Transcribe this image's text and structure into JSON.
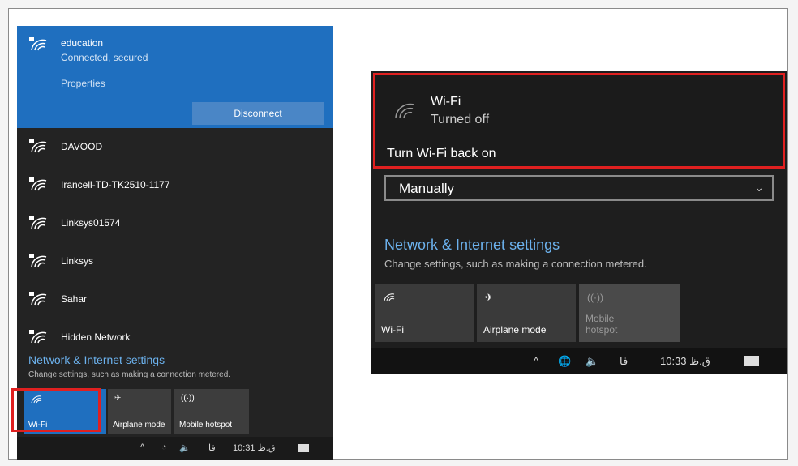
{
  "left": {
    "connected": {
      "name": "education",
      "status": "Connected, secured",
      "properties": "Properties",
      "disconnect": "Disconnect"
    },
    "networks": [
      "DAVOOD",
      "Irancell-TD-TK2510-1177",
      "Linksys01574",
      "Linksys",
      "Sahar",
      "Hidden Network"
    ],
    "settings_title": "Network & Internet settings",
    "settings_sub": "Change settings, such as making a connection metered.",
    "tiles": [
      {
        "label": "Wi-Fi"
      },
      {
        "label": "Airplane mode"
      },
      {
        "label": "Mobile hotspot"
      }
    ],
    "taskbar": {
      "lang": "فا",
      "time": "10:31 ق.ظ"
    }
  },
  "right": {
    "wifi_title": "Wi-Fi",
    "wifi_status": "Turned off",
    "turn_back": "Turn Wi-Fi back on",
    "select_value": "Manually",
    "settings_title": "Network & Internet settings",
    "settings_sub": "Change settings, such as making a connection metered.",
    "tiles": [
      {
        "label": "Wi-Fi"
      },
      {
        "label": "Airplane mode"
      },
      {
        "label": "Mobile hotspot"
      }
    ],
    "taskbar": {
      "lang": "فا",
      "time": "10:33 ق.ظ"
    }
  },
  "colors": {
    "accent": "#1f6fbf",
    "link": "#6cb2ee",
    "highlight": "#e02020",
    "panel": "#232323"
  }
}
